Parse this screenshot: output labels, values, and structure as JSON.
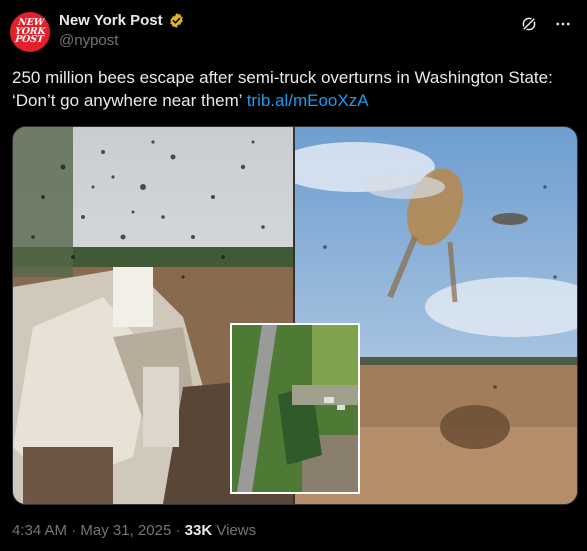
{
  "account": {
    "display_name": "New York Post",
    "handle": "@nypost",
    "avatar_lines": [
      "NEW",
      "YORK",
      "POST"
    ]
  },
  "icons": {
    "verified": "verified-badge-icon",
    "grok": "grok-icon",
    "more": "more-icon"
  },
  "tweet": {
    "text": "250 million bees escape after semi-truck overturns in Washington State: ‘Don’t go anywhere near them’",
    "link": "trib.al/mEooXzA"
  },
  "meta": {
    "time": "4:34 AM",
    "separator": "·",
    "date": "May 31, 2025",
    "views_count": "33K",
    "views_label": "Views"
  },
  "colors": {
    "background": "#000000",
    "link": "#1d9bf0",
    "muted": "#71767b",
    "brand": "#e4202a",
    "verified": "#e2b719"
  }
}
